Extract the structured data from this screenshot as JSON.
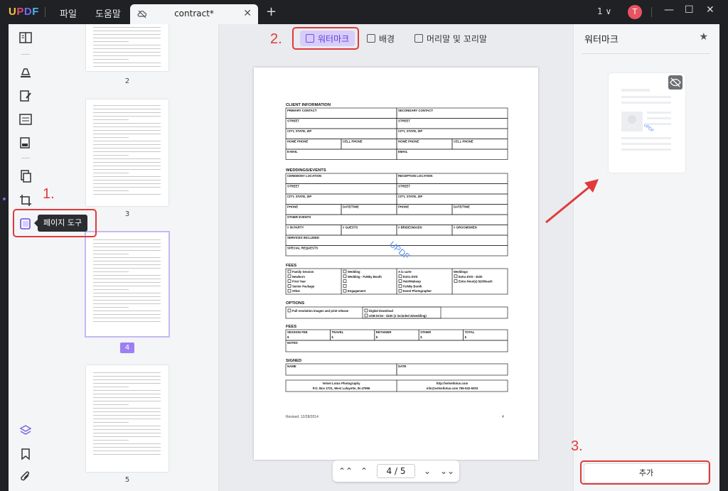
{
  "app": {
    "logo": {
      "u": "U",
      "p": "P",
      "d": "D",
      "f": "F"
    },
    "menu": {
      "file": "파일",
      "help": "도움말"
    },
    "tab": {
      "title": "contract*",
      "close": "✕"
    },
    "new_tab": "+",
    "page_count": "1 ∨",
    "user_initial": "T",
    "window": {
      "minimize": "—",
      "maximize": "☐",
      "close": "✕"
    }
  },
  "left_toolbar": {
    "page_tools_tooltip": "페이지 도구"
  },
  "thumbnails": [
    {
      "page": "2"
    },
    {
      "page": "3"
    },
    {
      "page": "4",
      "selected": true
    },
    {
      "page": "5"
    }
  ],
  "toolbar_tabs": {
    "watermark": "워터마크",
    "background": "배경",
    "header_footer": "머리말 및 꼬리말"
  },
  "document": {
    "sections": {
      "client": "CLIENT INFORMATION",
      "weddings": "WEDDINGS/EVENTS",
      "fees": "FEES",
      "options": "OPTIONS",
      "fees2": "FEES",
      "signed": "SIGNED"
    },
    "client_rows": [
      [
        "PRIMARY CONTACT",
        "SECONDARY CONTACT"
      ],
      [
        "STREET",
        "STREET"
      ],
      [
        "CITY, STATE, ZIP",
        "CITY, STATE, ZIP"
      ],
      [
        "HOME PHONE",
        "CELL PHONE",
        "HOME PHONE",
        "CELL PHONE"
      ],
      [
        "E-MAIL",
        "EMAIL"
      ]
    ],
    "event_rows": [
      [
        "CEREMONY LOCATION",
        "RECEPTION LOCATION"
      ],
      [
        "STREET",
        "STREET"
      ],
      [
        "CITY, STATE, ZIP",
        "CITY, STATE, ZIP"
      ],
      [
        "PHONE",
        "DATE/TIME",
        "PHONE",
        "DATE/TIME"
      ],
      [
        "OTHER EVENTS"
      ],
      [
        "# IN PARTY",
        "# GUESTS",
        "# BRIDESMAIDS",
        "# GROOMSMEN"
      ],
      [
        "SERVICES INCLUDED"
      ],
      [
        "SPECIAL REQUESTS"
      ]
    ],
    "fees_cols": [
      [
        "Family Session",
        "Newborn",
        "First Year",
        "Senior Package",
        "Other"
      ],
      [
        "Wedding",
        "Wedding - FUNky Booth",
        "",
        "",
        "Engagement"
      ],
      [
        "A la carte",
        "Extra DVD",
        "Hair/Makeup",
        "FUNky Booth",
        "Event Photographer"
      ],
      [
        "Weddings",
        "Extra DVD - $100",
        "Extra Hour(s) $200/each"
      ]
    ],
    "options": [
      "Full resolution images and print release",
      "Digital Download",
      "USB Drive - $100 (1 included w/wedding)"
    ],
    "fee_totals": [
      "SESSION FEE",
      "TRAVEL",
      "RETAINER",
      "OTHER",
      "TOTAL"
    ],
    "currency": "$",
    "notes": "NOTES",
    "sign_cols": [
      "NAME",
      "DATE"
    ],
    "footer_left": "Velvet Lotus Photography",
    "footer_left2": "P.O. Box 2721, West Lafayette, IN 47996",
    "footer_right": "http://velvetlotus.com",
    "footer_right2": "info@velvetlotus.com 765-532-5003",
    "revised": "Revised: 12/28/2014",
    "page_number": "4",
    "watermark_text": "UPDF"
  },
  "nav": {
    "first": "⌃⌃",
    "prev": "⌃",
    "page_display": "4 / 5",
    "next": "⌄",
    "last": "⌄⌄"
  },
  "right_panel": {
    "title": "워터마크",
    "star": "★",
    "add_button": "추가"
  },
  "annotations": {
    "step1": "1.",
    "step2": "2.",
    "step3": "3."
  },
  "colors": {
    "accent": "#7468e8",
    "annotation_red": "#e03a3a",
    "watermark_blue": "#5b8ff5"
  }
}
